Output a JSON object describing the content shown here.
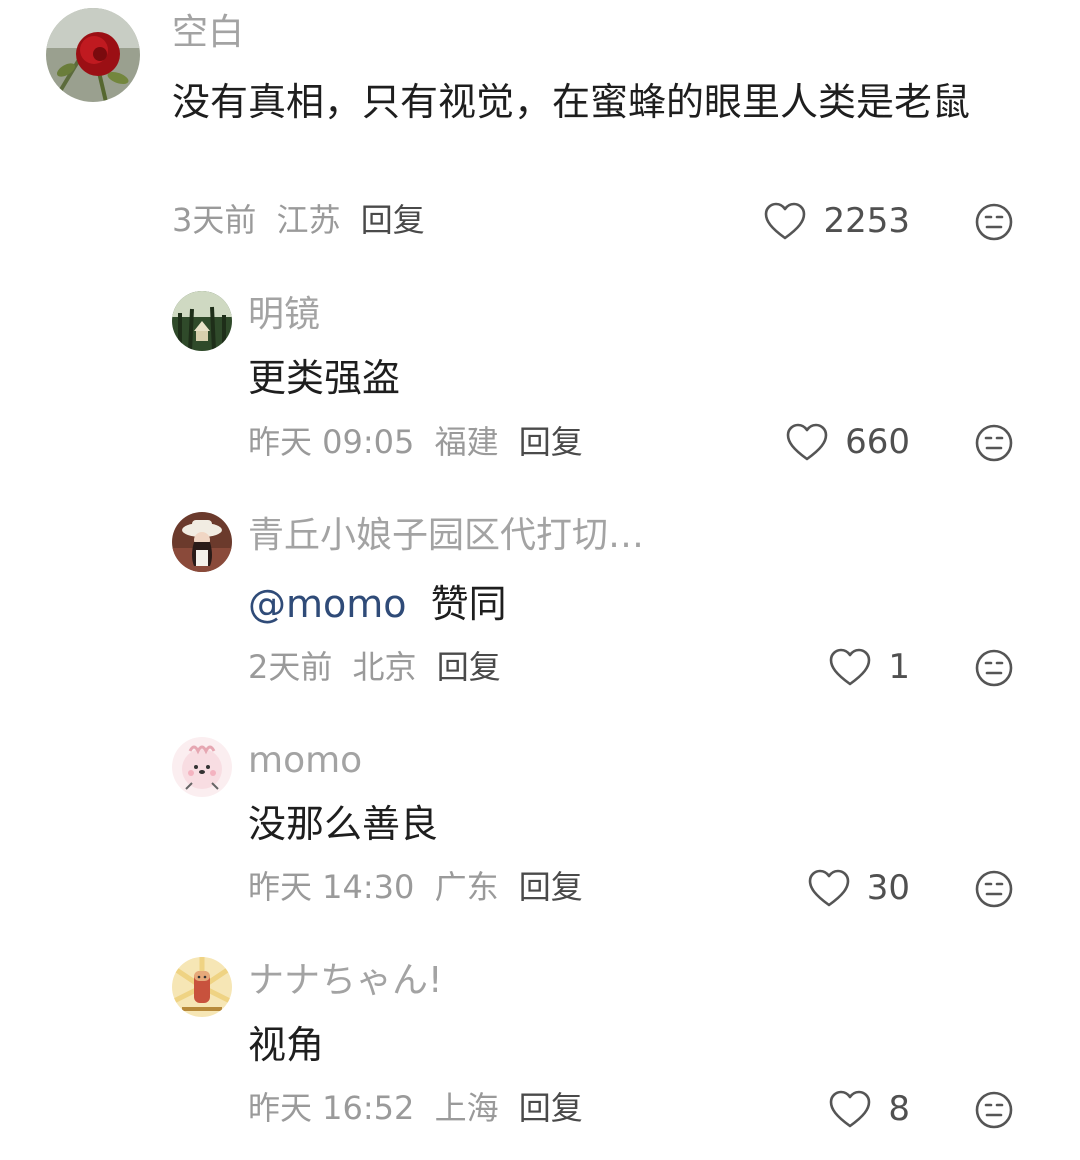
{
  "comments": [
    {
      "name": "空白",
      "text": "没有真相，只有视觉，在蜜蜂的眼里人类是老鼠",
      "time": "3天前",
      "location": "江苏",
      "reply": "回复",
      "likes": "2253",
      "avatar_icon": "red-rose-avatar"
    },
    {
      "name": "明镜",
      "text": "更类强盗",
      "time": "昨天 09:05",
      "location": "福建",
      "reply": "回复",
      "likes": "660",
      "avatar_icon": "forest-temple-avatar"
    },
    {
      "name": "青丘小娘子园区代打切…",
      "mention": "@momo",
      "text": "赞同",
      "time": "2天前",
      "location": "北京",
      "reply": "回复",
      "likes": "1",
      "avatar_icon": "woman-hat-avatar"
    },
    {
      "name": "momo",
      "text": "没那么善良",
      "time": "昨天 14:30",
      "location": "广东",
      "reply": "回复",
      "likes": "30",
      "avatar_icon": "pink-cartoon-avatar"
    },
    {
      "name": "ナナちゃん!",
      "text": "视角",
      "time": "昨天 16:52",
      "location": "上海",
      "reply": "回复",
      "likes": "8",
      "avatar_icon": "cartoon-stick-avatar"
    }
  ],
  "colors": {
    "name": "#a3a3a3",
    "body_text": "#1e1e1e",
    "meta": "#9a9a9a",
    "mention": "#2f4b78"
  }
}
